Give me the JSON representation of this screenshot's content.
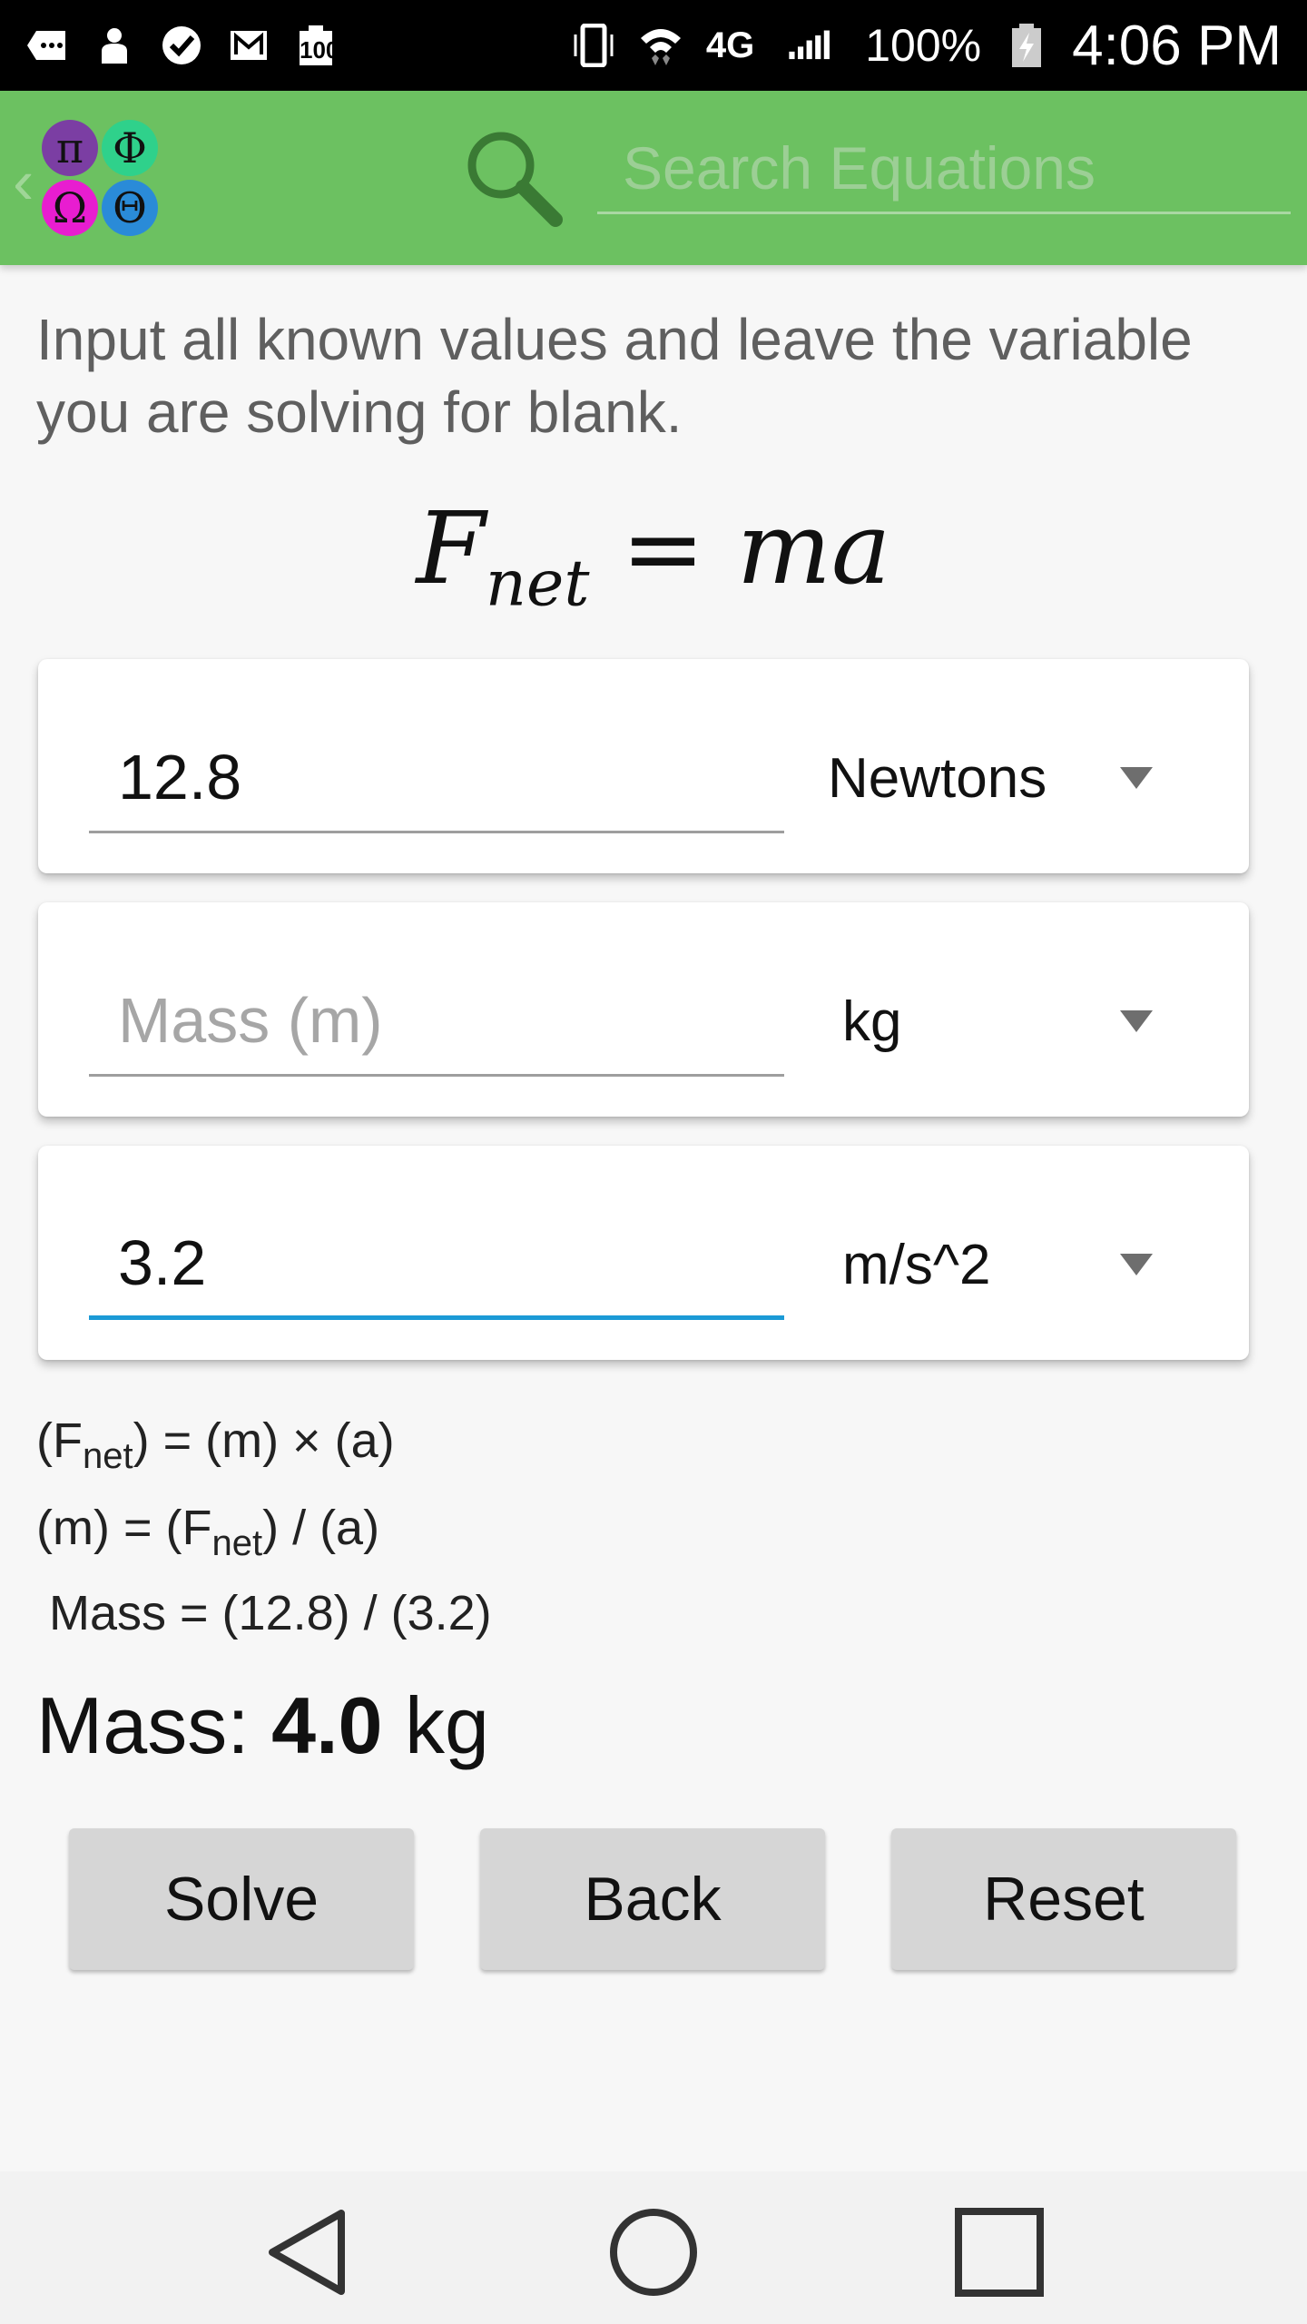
{
  "status_bar": {
    "battery_small": "100",
    "network": "4G",
    "battery_percent": "100%",
    "time": "4:06 PM"
  },
  "app_bar": {
    "logo_symbols": [
      "π",
      "Φ",
      "Ω",
      "Θ"
    ],
    "logo_colors": [
      "#7b3ea3",
      "#2fd18b",
      "#e81dd0",
      "#2a8bd8"
    ],
    "accent": "#6cc161",
    "search_placeholder": "Search Equations"
  },
  "content": {
    "instructions": "Input all known values and leave the variable you are solving for blank.",
    "equation": {
      "lhs": "F",
      "lhs_sub": "net",
      "eq": " = ",
      "rhs": "ma"
    },
    "fields": [
      {
        "value": "12.8",
        "placeholder": "",
        "unit": "Newtons",
        "focused": false
      },
      {
        "value": "",
        "placeholder": "Mass (m)",
        "unit": "kg",
        "focused": false
      },
      {
        "value": "3.2",
        "placeholder": "",
        "unit": "m/s^2",
        "focused": true
      }
    ],
    "derivation": {
      "line1_a": "(F",
      "line1_sub": "net",
      "line1_b": ") = (m) × (a)",
      "line2_a": "(m) = (F",
      "line2_sub": "net",
      "line2_b": ") / (a)",
      "line3": "Mass = (12.8) / (3.2)"
    },
    "result": {
      "label": "Mass: ",
      "value": "4.0",
      "unit": " kg"
    }
  },
  "buttons": {
    "solve": "Solve",
    "back": "Back",
    "reset": "Reset"
  },
  "colors": {
    "focus_underline": "#1b9ad6",
    "button_bg": "#d6d6d6"
  }
}
